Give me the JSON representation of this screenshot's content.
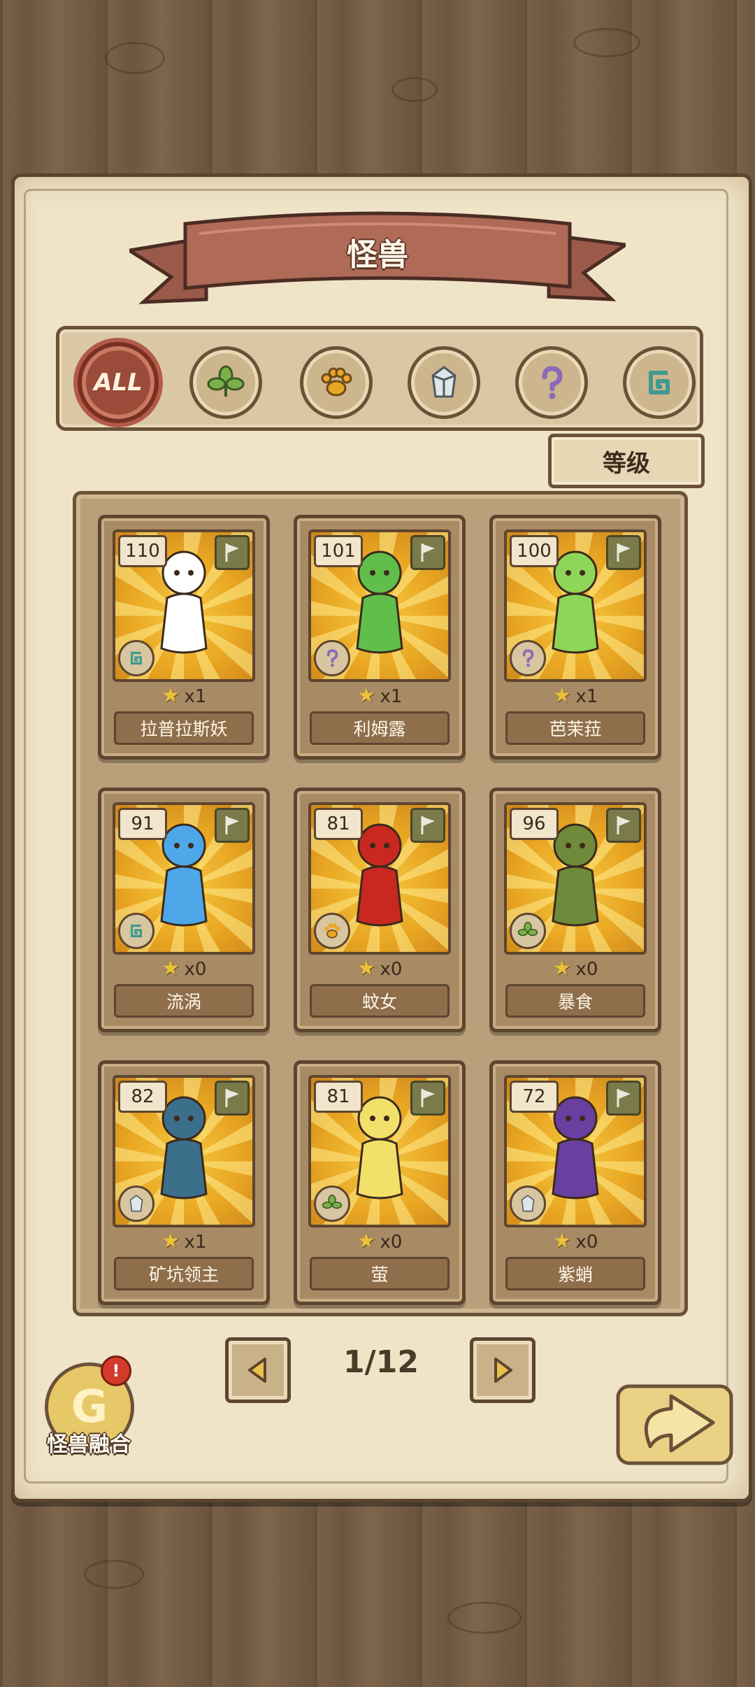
{
  "title": "怪兽",
  "filters": [
    {
      "label": "ALL",
      "icon": "all-icon",
      "active": true
    },
    {
      "label": "",
      "icon": "leaf-icon",
      "active": false
    },
    {
      "label": "",
      "icon": "paw-icon",
      "active": false
    },
    {
      "label": "",
      "icon": "crystal-icon",
      "active": false
    },
    {
      "label": "",
      "icon": "question-icon",
      "active": false
    },
    {
      "label": "",
      "icon": "spiral-icon",
      "active": false
    }
  ],
  "sort": {
    "label": "等级"
  },
  "monsters": [
    {
      "level": "110",
      "name": "拉普拉斯妖",
      "count": "x1",
      "type": "spiral",
      "color": "#ffffff"
    },
    {
      "level": "101",
      "name": "利姆露",
      "count": "x1",
      "type": "question",
      "color": "#5fbf4a"
    },
    {
      "level": "100",
      "name": "芭茉菈",
      "count": "x1",
      "type": "question",
      "color": "#8ed657"
    },
    {
      "level": "91",
      "name": "流涡",
      "count": "x0",
      "type": "spiral",
      "color": "#4ea7e8"
    },
    {
      "level": "81",
      "name": "蚊女",
      "count": "x0",
      "type": "paw",
      "color": "#c8281f"
    },
    {
      "level": "96",
      "name": "暴食",
      "count": "x0",
      "type": "leaf",
      "color": "#6f8a3a"
    },
    {
      "level": "82",
      "name": "矿坑领主",
      "count": "x1",
      "type": "crystal",
      "color": "#3c6f8a"
    },
    {
      "level": "81",
      "name": "萤",
      "count": "x0",
      "type": "leaf",
      "color": "#f2e06a"
    },
    {
      "level": "72",
      "name": "紫蛸",
      "count": "x0",
      "type": "crystal",
      "color": "#6a3fa0"
    }
  ],
  "pagination": {
    "label": "1/12"
  },
  "fusion": {
    "label": "怪兽融合",
    "alert": "!"
  }
}
